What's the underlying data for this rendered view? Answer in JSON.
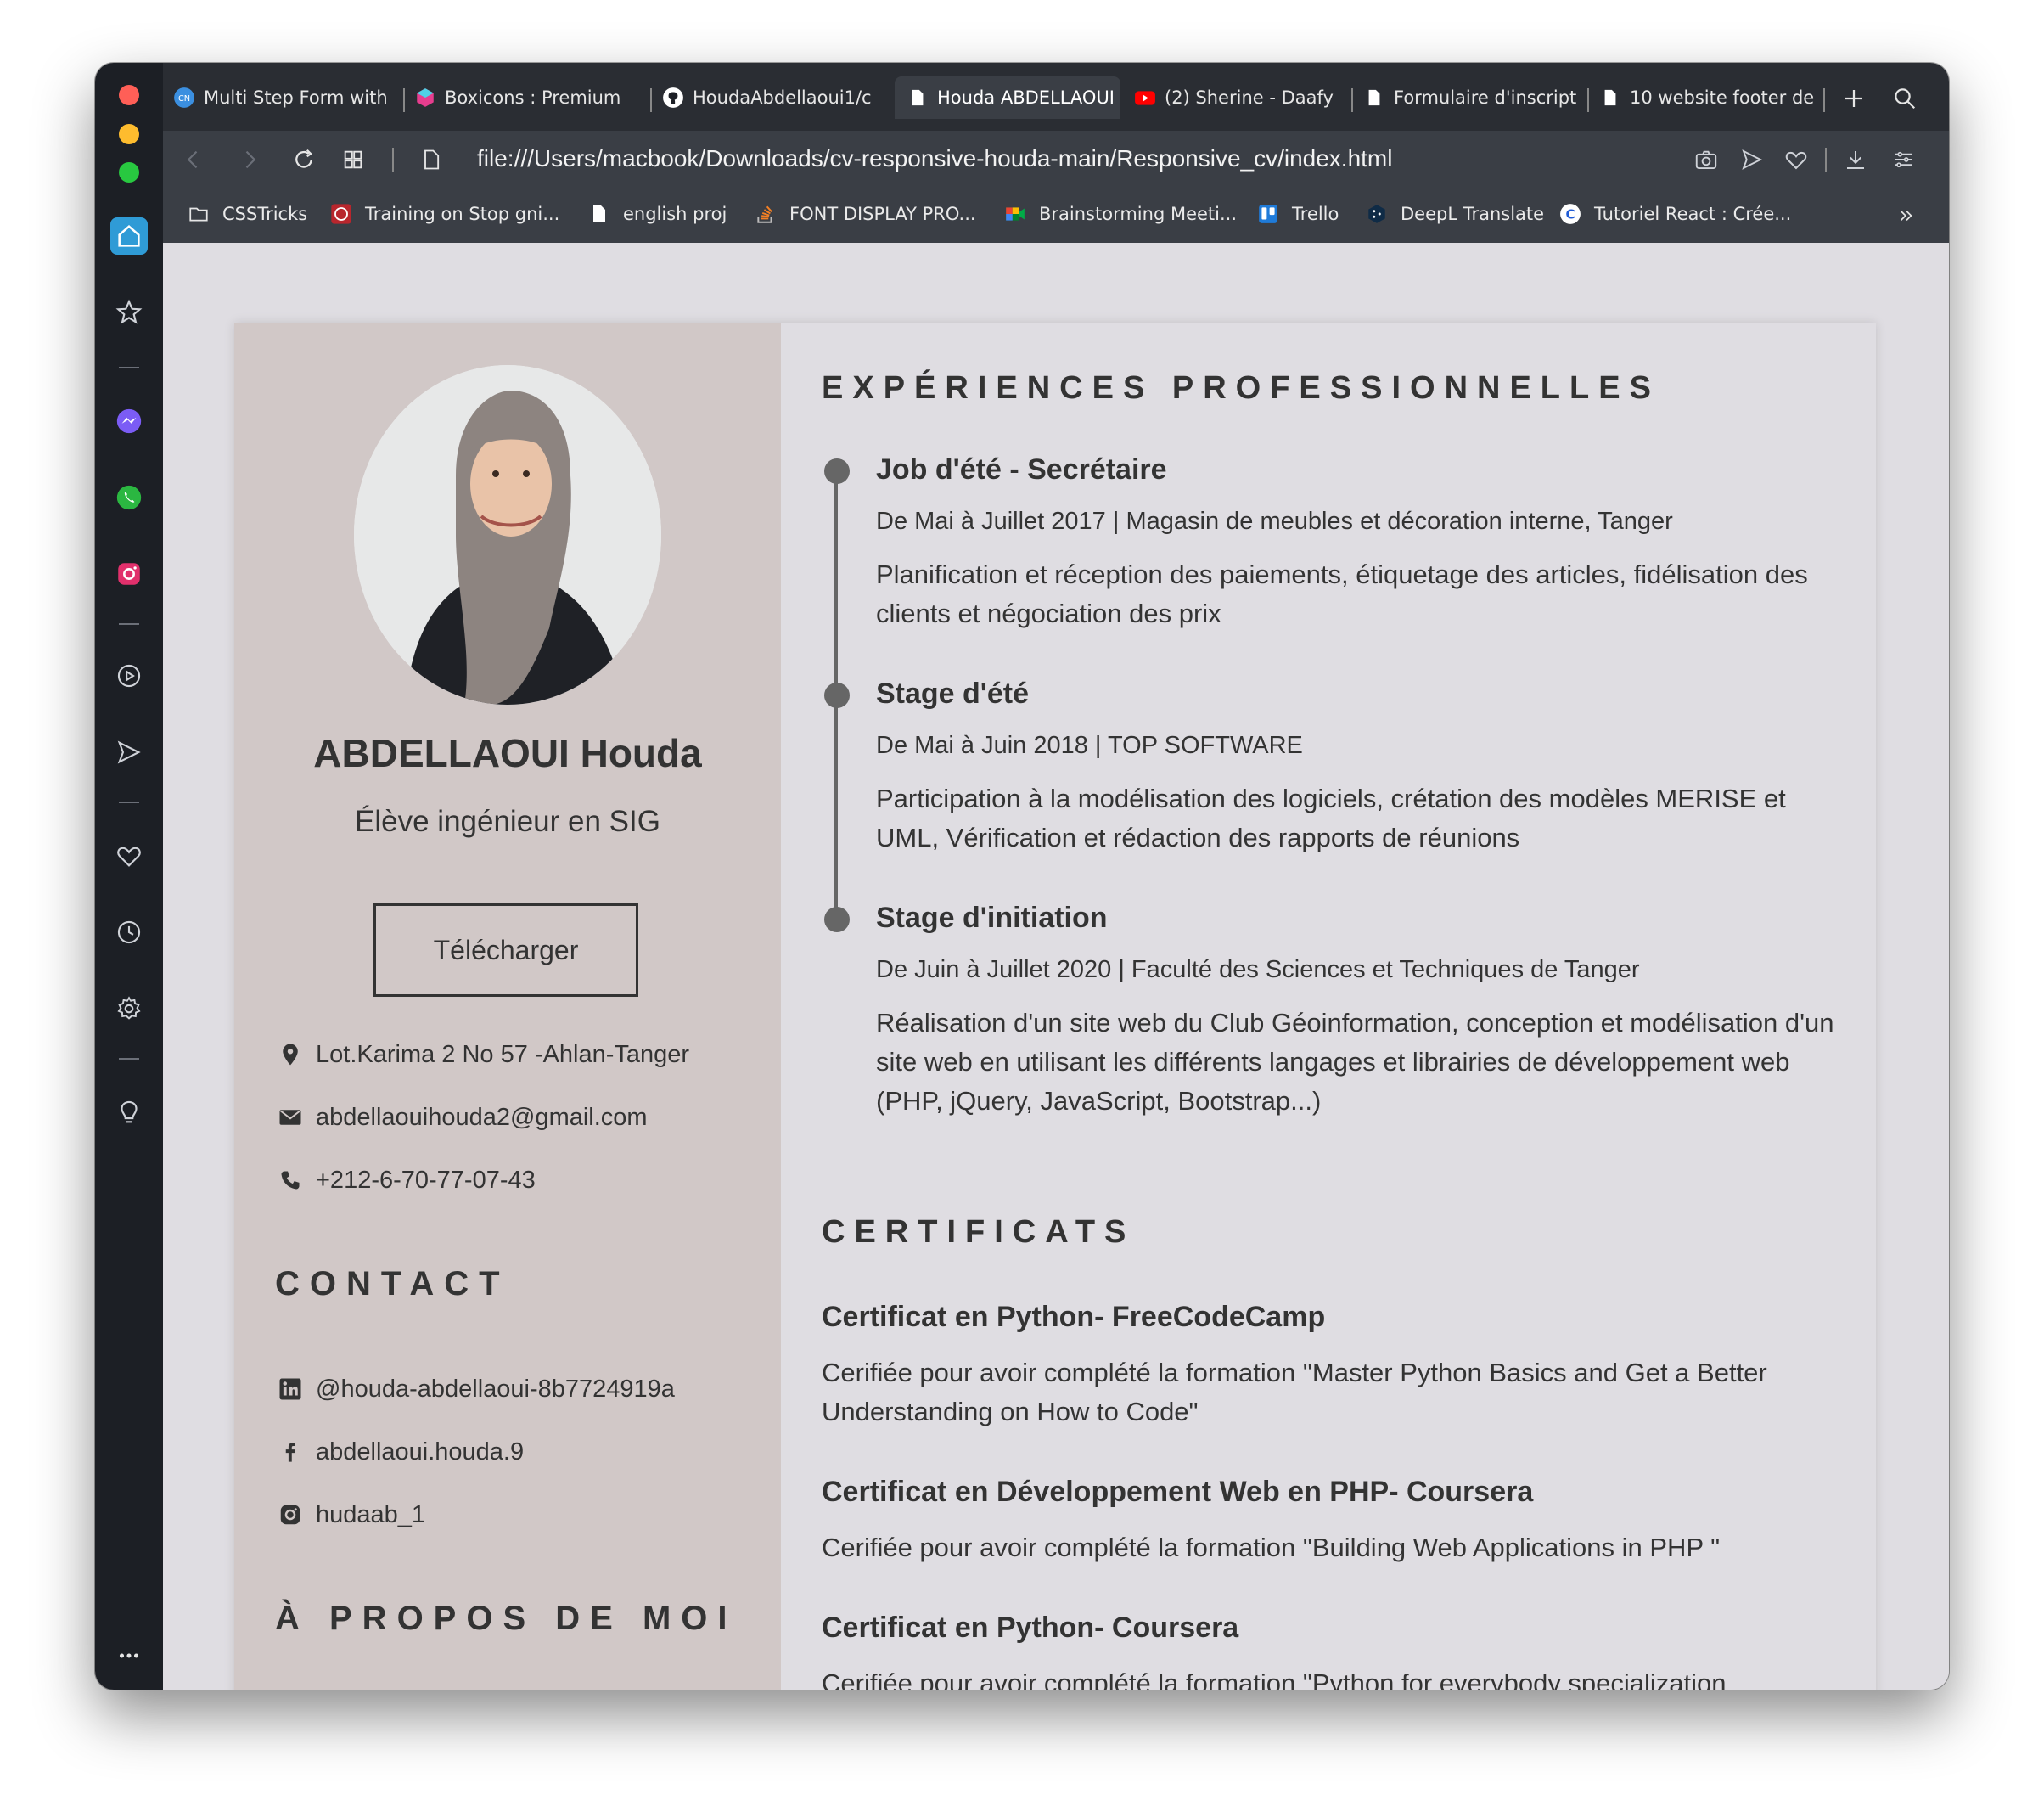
{
  "browser": {
    "tabs": [
      {
        "label": "Multi Step Form with",
        "icon": "codingnepal-icon"
      },
      {
        "label": "Boxicons : Premium",
        "icon": "boxicons-icon"
      },
      {
        "label": "HoudaAbdellaoui1/c",
        "icon": "github-icon"
      },
      {
        "label": "Houda ABDELLAOUI",
        "icon": "document-icon",
        "active": true
      },
      {
        "label": "(2) Sherine - Daafy",
        "icon": "youtube-icon"
      },
      {
        "label": "Formulaire d'inscript",
        "icon": "document-icon"
      },
      {
        "label": "10 website footer de",
        "icon": "document-icon"
      }
    ],
    "url": "file:///Users/macbook/Downloads/cv-responsive-houda-main/Responsive_cv/index.html",
    "bookmarks": [
      {
        "label": "CSSTricks",
        "icon": "folder-icon"
      },
      {
        "label": "Training on Stop gni...",
        "icon": "training-icon"
      },
      {
        "label": "english proj",
        "icon": "document-icon"
      },
      {
        "label": "FONT DISPLAY PRO...",
        "icon": "stackoverflow-icon"
      },
      {
        "label": "Brainstorming Meeti...",
        "icon": "meet-icon"
      },
      {
        "label": "Trello",
        "icon": "trello-icon"
      },
      {
        "label": "DeepL Translate",
        "icon": "deepl-icon"
      },
      {
        "label": "Tutoriel React : Crée...",
        "icon": "coursera-icon"
      }
    ]
  },
  "cv": {
    "name": "ABDELLAOUI Houda",
    "role": "Élève ingénieur en SIG",
    "download_label": "Télécharger",
    "address": "Lot.Karima 2 No 57 -Ahlan-Tanger",
    "email": "abdellaouihouda2@gmail.com",
    "phone": "+212-6-70-77-07-43",
    "contact_title": "CONTACT",
    "linkedin": "@houda-abdellaoui-8b7724919a",
    "facebook": "abdellaoui.houda.9",
    "instagram": "hudaab_1",
    "about_title": "À PROPOS DE MOI",
    "experience_title": "EXPÉRIENCES PROFESSIONNELLES",
    "experiences": [
      {
        "title": "Job d'été - Secrétaire",
        "meta": "De Mai à Juillet 2017 | Magasin de meubles et décoration interne, Tanger",
        "desc": "Planification et réception des paiements, étiquetage des articles, fidélisation des clients et négociation des prix"
      },
      {
        "title": "Stage d'été",
        "meta": "De Mai à Juin 2018 | TOP SOFTWARE",
        "desc": "Participation à la modélisation des logiciels, crétation des modèles MERISE et UML, Vérification et rédaction des rapports de réunions"
      },
      {
        "title": "Stage d'initiation",
        "meta": "De Juin à Juillet 2020 | Faculté des Sciences et Techniques de Tanger",
        "desc": "Réalisation d'un site web du Club Géoinformation, conception et modélisation d'un site web en utilisant les différents langages et librairies de développement web (PHP, jQuery, JavaScript, Bootstrap...)"
      }
    ],
    "certificates_title": "CERTIFICATS",
    "certificates": [
      {
        "title": "Certificat en Python- FreeCodeCamp",
        "desc": "Cerifiée pour avoir complété la formation \"Master Python Basics and Get a Better Understanding on How to Code\""
      },
      {
        "title": "Certificat en Développement Web en PHP- Coursera",
        "desc": "Cerifiée pour avoir complété la formation \"Building Web Applications in PHP \""
      },
      {
        "title": "Certificat en Python- Coursera",
        "desc": "Cerifiée pour avoir complété la formation \"Python for everybody specialization"
      }
    ]
  }
}
